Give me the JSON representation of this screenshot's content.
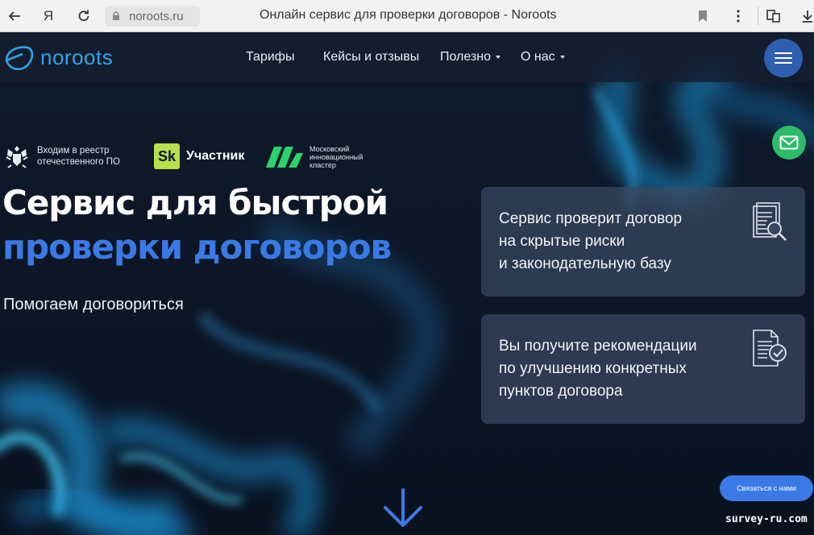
{
  "browser": {
    "url": "noroots.ru",
    "tab_title": "Онлайн сервис для проверки договоров - Noroots",
    "yandex_icon": "Я"
  },
  "header": {
    "logo": "noroots",
    "nav": [
      {
        "label": "Тарифы"
      },
      {
        "label": "Кейсы и отзывы"
      },
      {
        "label": "Полезно"
      },
      {
        "label": "О нас"
      }
    ]
  },
  "badges": {
    "registry": {
      "line1": "Входим в реестр",
      "line2": "отечественного ПО"
    },
    "skolkovo": {
      "mark": "Sk",
      "label": "Участник"
    },
    "mik": {
      "line1": "Московский",
      "line2": "инновационный",
      "line3": "кластер"
    }
  },
  "hero": {
    "title_line1": "Сервис для быстрой",
    "title_line2": "проверки договоров",
    "subtitle": "Помогаем договориться"
  },
  "cards": [
    {
      "line1": "Сервис проверит договор",
      "line2": "на скрытые риски",
      "line3": "и законодательную базу",
      "icon": "document-search-icon"
    },
    {
      "line1": "Вы получите рекомендации",
      "line2": "по улучшению конкретных",
      "line3": "пунктов договора",
      "icon": "document-check-icon"
    }
  ],
  "contact_button": "Связаться с нами",
  "watermark": "survey-ru.com",
  "colors": {
    "accent": "#3a7ae6",
    "logo": "#2ea4e8",
    "mail": "#2dbb69",
    "skolkovo": "#b6e14a"
  }
}
